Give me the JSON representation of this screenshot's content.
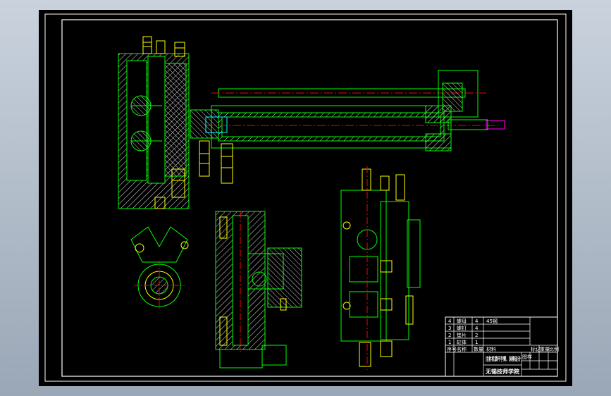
{
  "drawing": {
    "colors": {
      "background": "#000000",
      "sheet_border": "#ffffff",
      "outline": "#00ff00",
      "centerline": "#ff0000",
      "hatch": "#ffffff",
      "bolts": "#ffff00",
      "accent": "#00ffff",
      "highlight": "#ff00ff"
    },
    "title_block": {
      "parts_rows": [
        {
          "no": "4",
          "name": "螺母",
          "qty": "4",
          "material": "45钢"
        },
        {
          "no": "3",
          "name": "螺钉",
          "qty": "4",
          "material": ""
        },
        {
          "no": "2",
          "name": "垫片",
          "qty": "2",
          "material": ""
        },
        {
          "no": "1",
          "name": "缸体",
          "qty": "1",
          "material": ""
        }
      ],
      "header": {
        "no": "序号",
        "name": "名称",
        "qty": "数量",
        "material": "材料"
      },
      "title": "注射机锁杆手臂、装模设计",
      "school": "无锡技师学院",
      "stage_headers": [
        "图样",
        "标记",
        "重量",
        "比例"
      ]
    }
  }
}
